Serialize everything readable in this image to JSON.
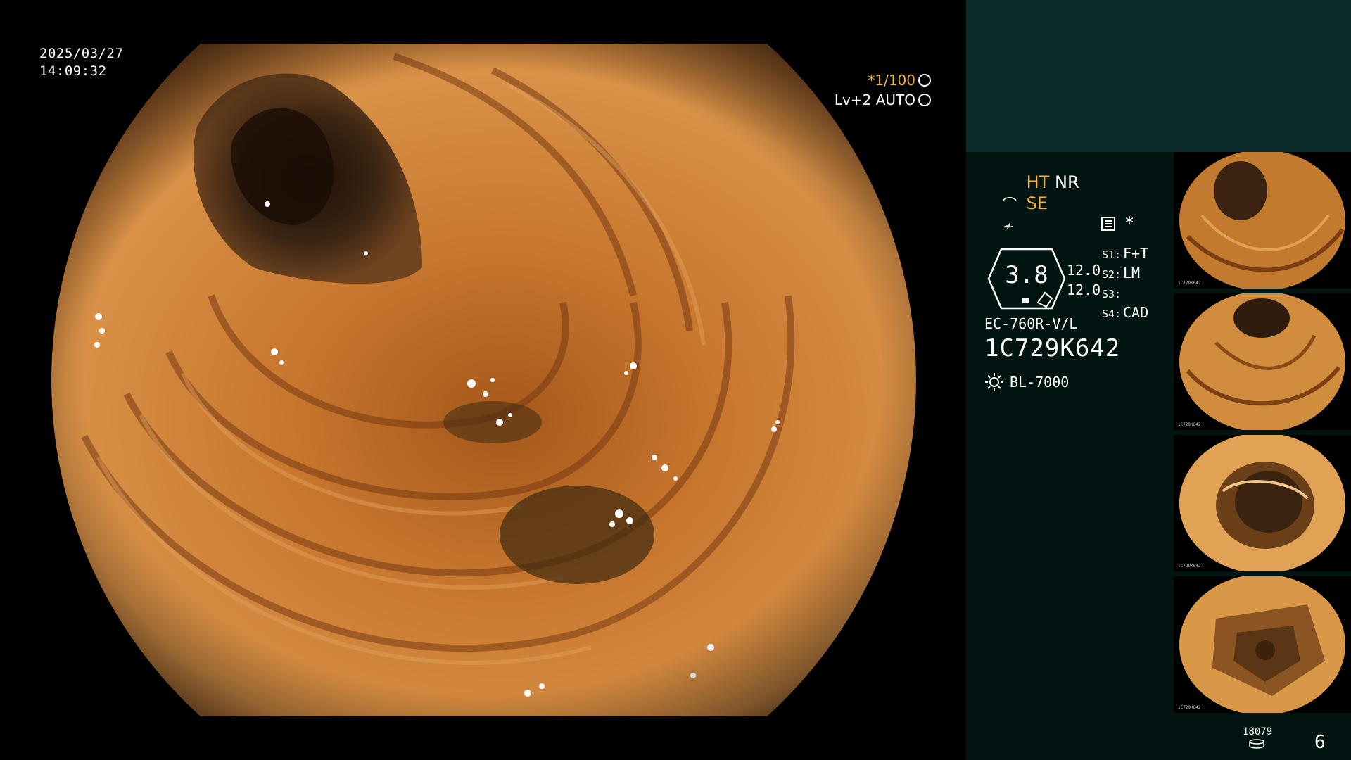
{
  "overlay": {
    "date": "2025/03/27",
    "time": "14:09:32",
    "shutter_speed": "*1/100",
    "iris_mode": "Lv+2 AUTO"
  },
  "status": {
    "mode_line1_a": "HT",
    "mode_line1_b": "NR",
    "mode_line2": "SE",
    "star": "*",
    "value_big": "3.8",
    "value_a": "12.0",
    "value_b": "12.0",
    "slots": [
      {
        "key": "S1:",
        "val": "F+T"
      },
      {
        "key": "S2:",
        "val": "LM"
      },
      {
        "key": "S3:",
        "val": ""
      },
      {
        "key": "S4:",
        "val": "CAD"
      }
    ]
  },
  "scope": {
    "model": "EC-760R-V/L",
    "serial": "1C729K642",
    "light_source": "BL-7000"
  },
  "thumbnails": [
    {
      "label": "1C729K642"
    },
    {
      "label": "1C729K642"
    },
    {
      "label": "1C729K642"
    },
    {
      "label": "1C729K642"
    }
  ],
  "footer": {
    "image_count": "18079",
    "page": "6"
  },
  "colors": {
    "amber": "#f2b33d",
    "panel_bg": "#021513",
    "panel_top": "#0b2b28"
  },
  "icons": [
    "iris-icon",
    "auto-iris-icon",
    "scope-angle-icon",
    "menu-icon",
    "light-source-icon",
    "storage-icon"
  ]
}
